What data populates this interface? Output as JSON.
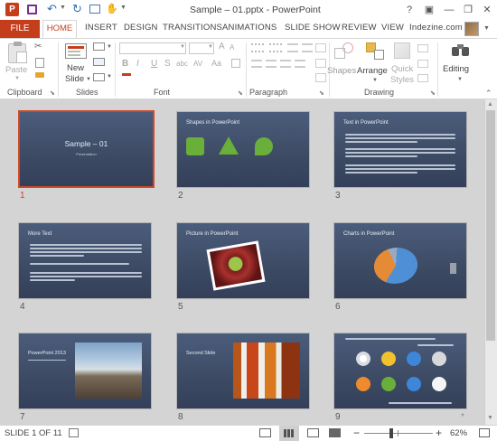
{
  "window": {
    "title": "Sample – 01.pptx - PowerPoint",
    "help": "?",
    "minimize": "—",
    "restore": "❐",
    "close": "✕",
    "ribbon_display": "▣"
  },
  "tabs": {
    "file": "FILE",
    "home": "HOME",
    "insert": "INSERT",
    "design": "DESIGN",
    "transitions": "TRANSITIONS",
    "animations": "ANIMATIONS",
    "slideshow": "SLIDE SHOW",
    "review": "REVIEW",
    "view": "VIEW",
    "account": "Indezine.com"
  },
  "ribbon": {
    "clipboard": {
      "label": "Clipboard",
      "paste": "Paste"
    },
    "slides": {
      "label": "Slides",
      "new_slide_1": "New",
      "new_slide_2": "Slide"
    },
    "font": {
      "label": "Font",
      "bold": "B",
      "italic": "I",
      "underline": "U",
      "strike": "S",
      "shadow": "abc",
      "spacing": "AV",
      "case": "Aa",
      "grow": "A",
      "shrink": "A"
    },
    "paragraph": {
      "label": "Paragraph"
    },
    "drawing": {
      "label": "Drawing",
      "shapes": "Shapes",
      "arrange": "Arrange",
      "quick_styles_1": "Quick",
      "quick_styles_2": "Styles"
    },
    "editing": {
      "label": "Editing"
    }
  },
  "slides": [
    {
      "num": "1",
      "title": "Sample – 01",
      "subtitle": "Presentation"
    },
    {
      "num": "2",
      "title": "Shapes in PowerPoint"
    },
    {
      "num": "3",
      "title": "Text in PowerPoint"
    },
    {
      "num": "4",
      "title": "More Text"
    },
    {
      "num": "5",
      "title": "Picture in PowerPoint"
    },
    {
      "num": "6",
      "title": "Charts in PowerPoint"
    },
    {
      "num": "7",
      "title": "PowerPoint 2013"
    },
    {
      "num": "8",
      "title": "Second Slide"
    },
    {
      "num": "9",
      "title": ""
    }
  ],
  "status": {
    "slide_info": "SLIDE 1 OF 11",
    "minus": "−",
    "plus": "+",
    "zoom": "62%",
    "zoom_level": 0.62
  },
  "colors": {
    "accent": "#c43e1c",
    "selection": "#d24726",
    "slide_bg": "#3d4a63",
    "shape_green": "#6aaf3a"
  }
}
